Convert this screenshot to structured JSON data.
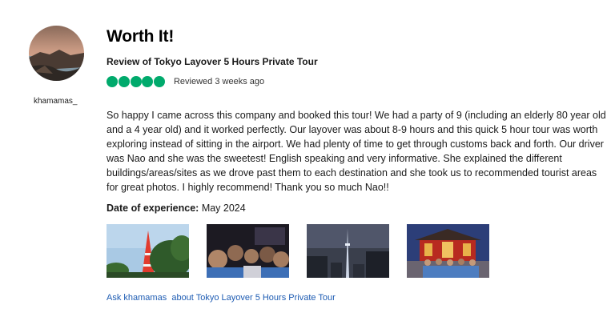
{
  "review": {
    "username": "khamamas_",
    "title": "Worth It!",
    "subtitle": "Review of Tokyo Layover 5 Hours Private Tour",
    "rating": 5,
    "rating_max": 5,
    "rating_color": "#00aa6c",
    "reviewed_when": "Reviewed 3 weeks ago",
    "body": "So happy I came across this company and booked this tour! We had a party of 9 (including an elderly 80 year old and a 4 year old) and it worked perfectly. Our layover was about 8-9 hours and this quick 5 hour tour was worth exploring instead of sitting in the airport. We had plenty of time to get through customs back and forth. Our driver was Nao and she was the sweetest! English speaking and very informative. She explained the different buildings/areas/sites as we drove past them to each destination and she took us to recommended tourist areas for great photos. I highly recommend! Thank you so much Nao!!",
    "date_label": "Date of experience:",
    "date_value": "May 2024",
    "ask_user": "Ask khamamas",
    "ask_about": "about Tokyo Layover 5 Hours Private Tour",
    "link_color": "#1e5cb3"
  },
  "photos": [
    {
      "name": "tokyo-tower-photo"
    },
    {
      "name": "group-night-selfie-photo"
    },
    {
      "name": "skytree-night-photo"
    },
    {
      "name": "sensoji-temple-group-photo"
    }
  ]
}
